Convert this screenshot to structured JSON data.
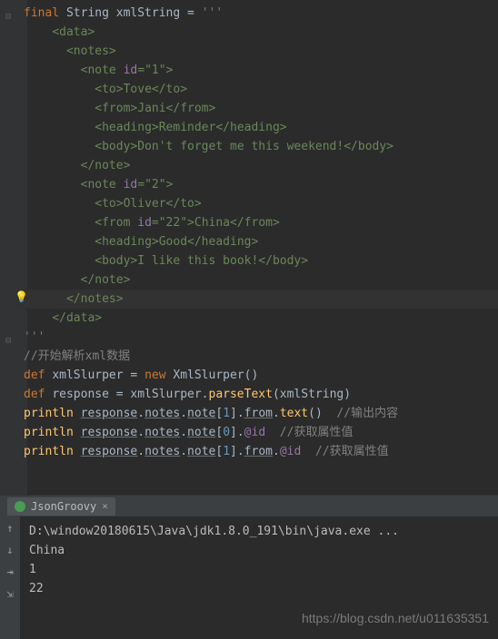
{
  "editor": {
    "lines": [
      {
        "indent": 0,
        "fold": "open",
        "segs": [
          {
            "t": "final ",
            "c": "kw"
          },
          {
            "t": "String xmlString = ",
            "c": "ident"
          },
          {
            "t": "'''",
            "c": "str"
          }
        ]
      },
      {
        "indent": 4,
        "segs": [
          {
            "t": "<data>",
            "c": "str"
          }
        ]
      },
      {
        "indent": 6,
        "segs": [
          {
            "t": "<notes>",
            "c": "str"
          }
        ]
      },
      {
        "indent": 8,
        "segs": [
          {
            "t": "<note ",
            "c": "str"
          },
          {
            "t": "id",
            "c": "attr"
          },
          {
            "t": "=",
            "c": "str"
          },
          {
            "t": "\"1\"",
            "c": "str"
          },
          {
            "t": ">",
            "c": "str"
          }
        ]
      },
      {
        "indent": 9,
        "segs": [
          {
            "t": "<to>Tove</to>",
            "c": "str"
          }
        ]
      },
      {
        "indent": 9,
        "segs": [
          {
            "t": "<from>Jani</from>",
            "c": "str"
          }
        ]
      },
      {
        "indent": 9,
        "segs": [
          {
            "t": "<heading>Reminder</heading>",
            "c": "str"
          }
        ]
      },
      {
        "indent": 9,
        "segs": [
          {
            "t": "<body>Don't forget me this weekend!</body>",
            "c": "str"
          }
        ]
      },
      {
        "indent": 8,
        "segs": [
          {
            "t": "</note>",
            "c": "str"
          }
        ]
      },
      {
        "indent": 8,
        "segs": [
          {
            "t": "<note ",
            "c": "str"
          },
          {
            "t": "id",
            "c": "attr"
          },
          {
            "t": "=",
            "c": "str"
          },
          {
            "t": "\"2\"",
            "c": "str"
          },
          {
            "t": ">",
            "c": "str"
          }
        ]
      },
      {
        "indent": 9,
        "segs": [
          {
            "t": "<to>Oliver</to>",
            "c": "str"
          }
        ]
      },
      {
        "indent": 9,
        "segs": [
          {
            "t": "<from ",
            "c": "str"
          },
          {
            "t": "id",
            "c": "attr"
          },
          {
            "t": "=",
            "c": "str"
          },
          {
            "t": "\"22\"",
            "c": "str"
          },
          {
            "t": ">China</from>",
            "c": "str"
          }
        ]
      },
      {
        "indent": 9,
        "segs": [
          {
            "t": "<heading>Good</heading>",
            "c": "str"
          }
        ]
      },
      {
        "indent": 9,
        "segs": [
          {
            "t": "<body>I like this book!</body>",
            "c": "str"
          }
        ]
      },
      {
        "indent": 8,
        "segs": [
          {
            "t": "</note>",
            "c": "str"
          }
        ]
      },
      {
        "indent": 6,
        "highlight": true,
        "segs": [
          {
            "t": "</notes>",
            "c": "str"
          }
        ]
      },
      {
        "indent": 4,
        "segs": [
          {
            "t": "</data>",
            "c": "str"
          }
        ]
      },
      {
        "indent": 0,
        "segs": [
          {
            "t": "",
            "c": ""
          }
        ]
      },
      {
        "indent": 0,
        "fold": "open",
        "segs": [
          {
            "t": "'''",
            "c": "str"
          }
        ]
      },
      {
        "indent": 0,
        "segs": [
          {
            "t": "//开始解析xml数据",
            "c": "comment"
          }
        ]
      },
      {
        "indent": 0,
        "segs": [
          {
            "t": "def ",
            "c": "kw"
          },
          {
            "t": "xmlSlurper = ",
            "c": "ident"
          },
          {
            "t": "new ",
            "c": "kw"
          },
          {
            "t": "XmlSlurper()",
            "c": "ident"
          }
        ]
      },
      {
        "indent": 0,
        "segs": [
          {
            "t": "def ",
            "c": "kw"
          },
          {
            "t": "response = xmlSlurper.",
            "c": "ident"
          },
          {
            "t": "parseText",
            "c": "method"
          },
          {
            "t": "(xmlString)",
            "c": "ident"
          }
        ]
      },
      {
        "indent": 0,
        "segs": [
          {
            "t": "println ",
            "c": "method"
          },
          {
            "t": "response",
            "c": "underlined"
          },
          {
            "t": ".",
            "c": "ident"
          },
          {
            "t": "notes",
            "c": "underlined"
          },
          {
            "t": ".",
            "c": "ident"
          },
          {
            "t": "note",
            "c": "underlined"
          },
          {
            "t": "[",
            "c": "ident"
          },
          {
            "t": "1",
            "c": "num"
          },
          {
            "t": "].",
            "c": "ident"
          },
          {
            "t": "from",
            "c": "underlined"
          },
          {
            "t": ".",
            "c": "ident"
          },
          {
            "t": "text",
            "c": "method"
          },
          {
            "t": "()",
            "c": "ident"
          },
          {
            "t": "  //输出内容",
            "c": "comment"
          }
        ]
      },
      {
        "indent": 0,
        "segs": [
          {
            "t": "println ",
            "c": "method"
          },
          {
            "t": "response",
            "c": "underlined"
          },
          {
            "t": ".",
            "c": "ident"
          },
          {
            "t": "notes",
            "c": "underlined"
          },
          {
            "t": ".",
            "c": "ident"
          },
          {
            "t": "note",
            "c": "underlined"
          },
          {
            "t": "[",
            "c": "ident"
          },
          {
            "t": "0",
            "c": "num"
          },
          {
            "t": "].",
            "c": "ident"
          },
          {
            "t": "@id",
            "c": "property"
          },
          {
            "t": "  //获取属性值",
            "c": "comment"
          }
        ]
      },
      {
        "indent": 0,
        "segs": [
          {
            "t": "println ",
            "c": "method"
          },
          {
            "t": "response",
            "c": "underlined"
          },
          {
            "t": ".",
            "c": "ident"
          },
          {
            "t": "notes",
            "c": "underlined"
          },
          {
            "t": ".",
            "c": "ident"
          },
          {
            "t": "note",
            "c": "underlined"
          },
          {
            "t": "[",
            "c": "ident"
          },
          {
            "t": "1",
            "c": "num"
          },
          {
            "t": "].",
            "c": "ident"
          },
          {
            "t": "from",
            "c": "underlined"
          },
          {
            "t": ".",
            "c": "ident"
          },
          {
            "t": "@id",
            "c": "property"
          },
          {
            "t": "  //获取属性值",
            "c": "comment"
          }
        ]
      }
    ]
  },
  "tab": {
    "label": "JsonGroovy",
    "close": "×"
  },
  "console": {
    "lines": [
      "D:\\window20180615\\Java\\jdk1.8.0_191\\bin\\java.exe ...",
      "China",
      "1",
      "22"
    ]
  },
  "watermark": "https://blog.csdn.net/u011635351",
  "icons": {
    "bulb": "💡",
    "up": "↑",
    "down": "↓",
    "wrap": "⇥",
    "scroll": "⇲"
  }
}
